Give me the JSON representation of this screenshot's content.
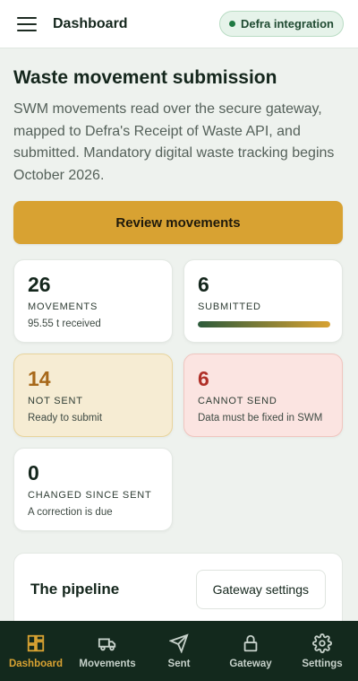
{
  "header": {
    "title": "Dashboard",
    "badge": "Defra integration"
  },
  "main": {
    "title": "Waste movement submission",
    "lede": "SWM movements read over the secure gateway, mapped to Defra's Receipt of Waste API, and submitted. Mandatory digital waste tracking begins October 2026.",
    "primary_button": "Review movements"
  },
  "stats": [
    {
      "value": "26",
      "label": "MOVEMENTS",
      "sub": "95.55 t received"
    },
    {
      "value": "6",
      "label": "SUBMITTED",
      "progress": 1.0
    },
    {
      "value": "14",
      "label": "NOT SENT",
      "sub": "Ready to submit"
    },
    {
      "value": "6",
      "label": "CANNOT SEND",
      "sub": "Data must be fixed in SWM"
    },
    {
      "value": "0",
      "label": "CHANGED SINCE SENT",
      "sub": "A correction is due"
    }
  ],
  "pipeline": {
    "title": "The pipeline",
    "button": "Gateway settings"
  },
  "nav": [
    {
      "label": "Dashboard",
      "icon": "dashboard-icon",
      "active": true
    },
    {
      "label": "Movements",
      "icon": "truck-icon"
    },
    {
      "label": "Sent",
      "icon": "send-icon"
    },
    {
      "label": "Gateway",
      "icon": "lock-icon"
    },
    {
      "label": "Settings",
      "icon": "gear-icon"
    }
  ],
  "colors": {
    "accent": "#d8a232",
    "nav_bg": "#13291d",
    "warn_bg": "#f6ecd3",
    "error_bg": "#fbe4e1"
  }
}
